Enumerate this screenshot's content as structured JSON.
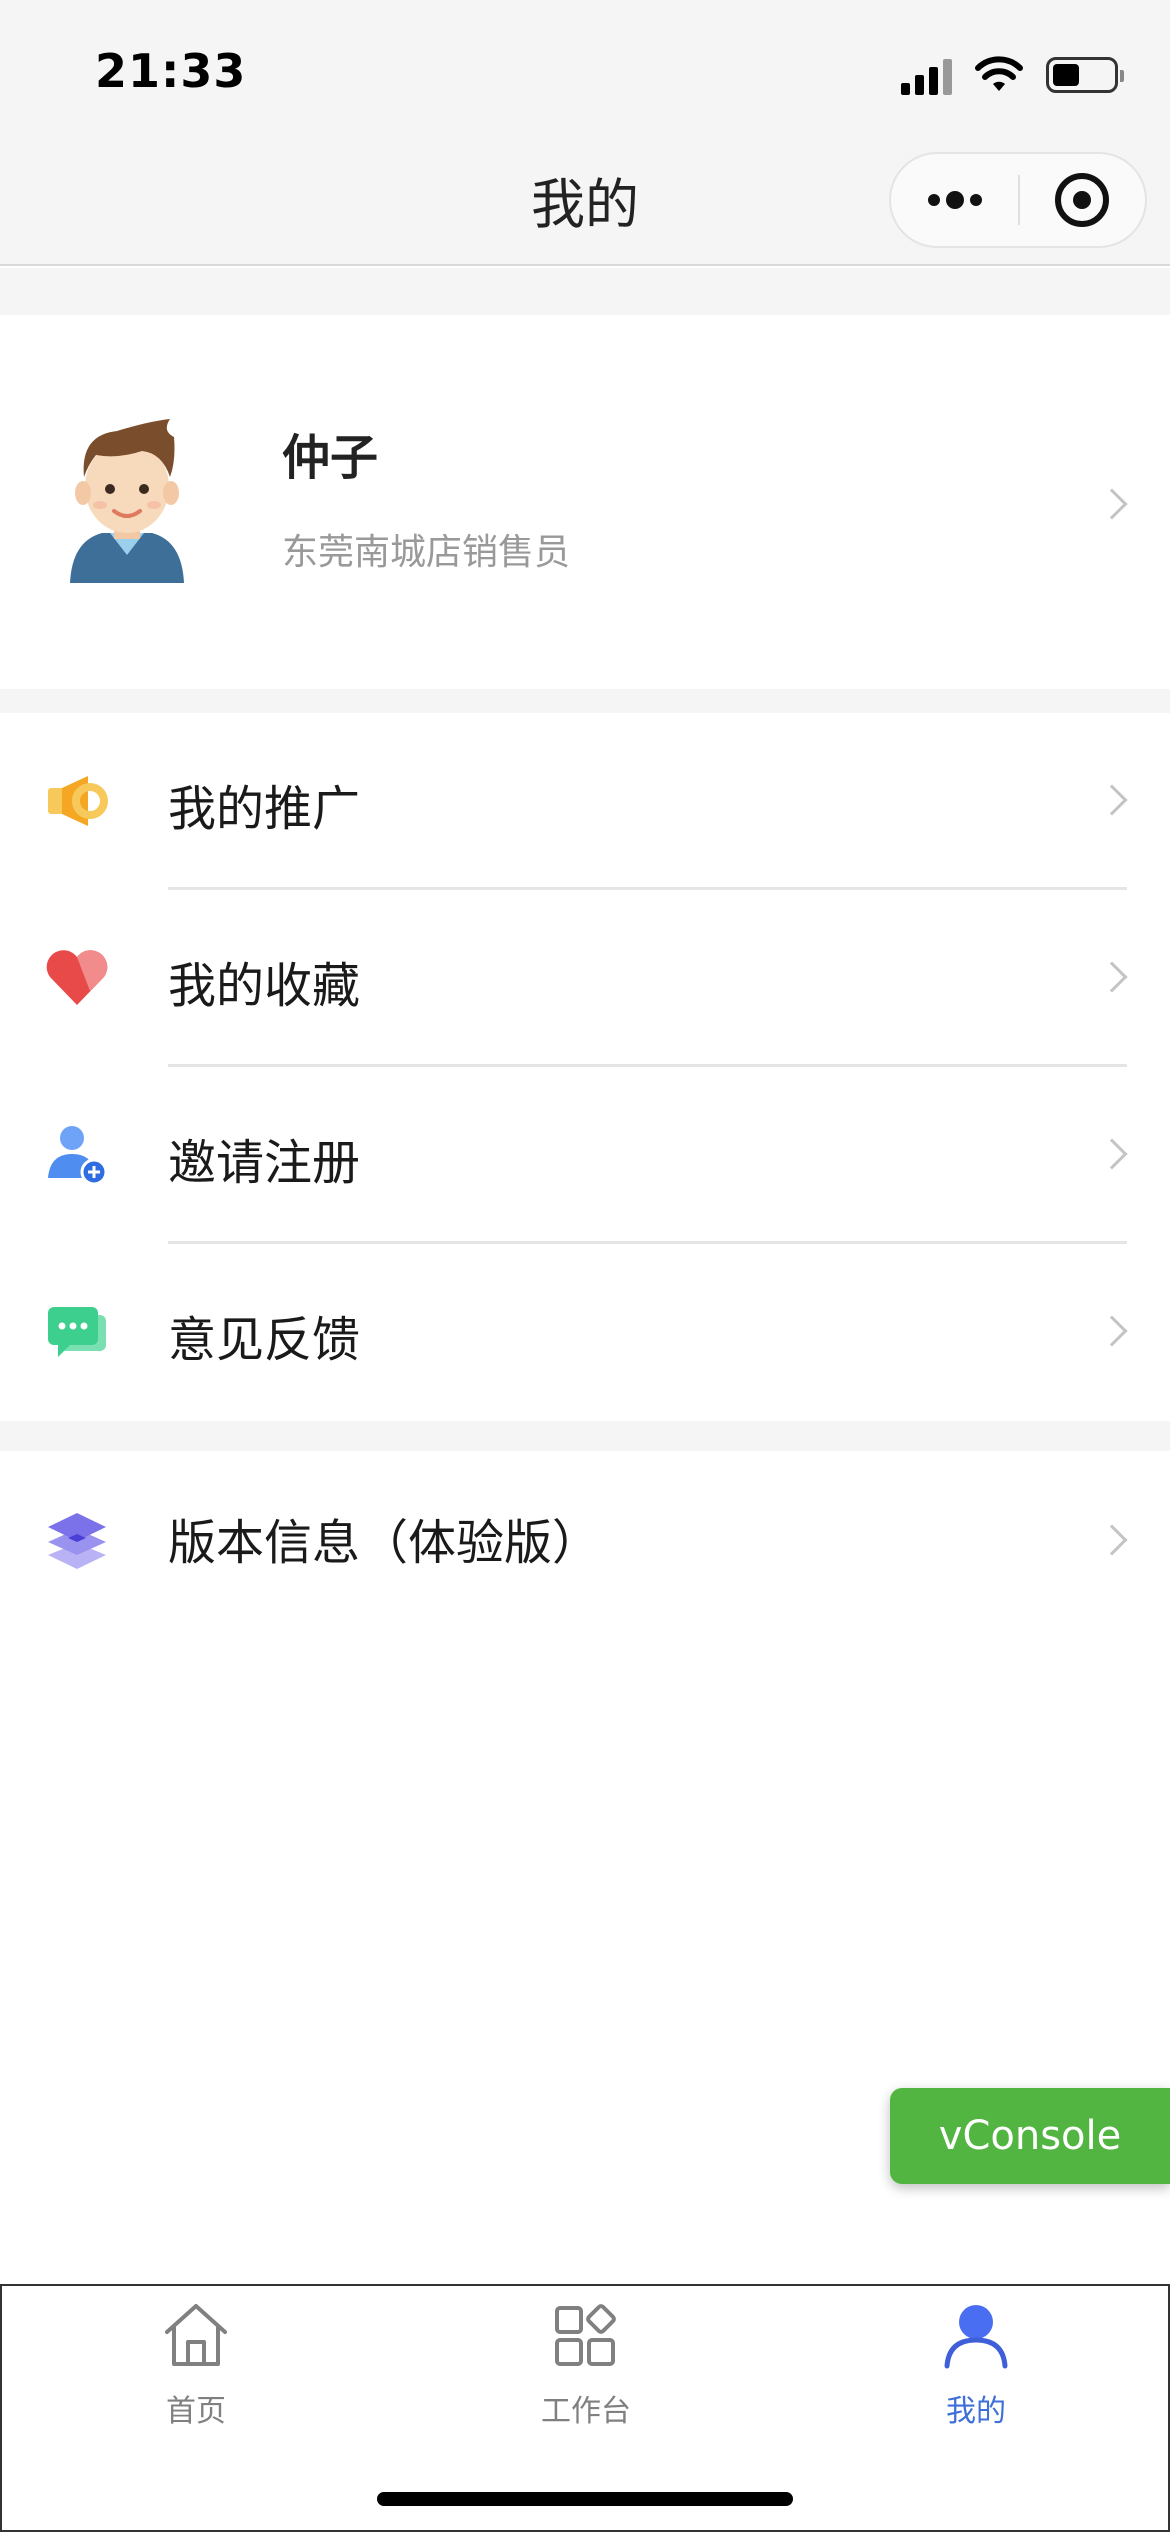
{
  "status_bar": {
    "time": "21:33",
    "battery_level": 0.45
  },
  "nav": {
    "title": "我的"
  },
  "profile": {
    "name": "仲子",
    "role": "东莞南城店销售员"
  },
  "menu": [
    {
      "label": "我的推广",
      "icon": "megaphone-icon",
      "color": "#f5a623"
    },
    {
      "label": "我的收藏",
      "icon": "heart-icon",
      "color": "#e84a4a"
    },
    {
      "label": "邀请注册",
      "icon": "add-user-icon",
      "color": "#4f8ef0"
    },
    {
      "label": "意见反馈",
      "icon": "chat-bubble-icon",
      "color": "#3ccf8e"
    }
  ],
  "version": {
    "label": "版本信息（体验版）",
    "icon": "layers-icon",
    "color": "#7b72e9"
  },
  "vconsole": {
    "label": "vConsole"
  },
  "tabbar": {
    "items": [
      {
        "label": "首页",
        "icon": "home-icon"
      },
      {
        "label": "工作台",
        "icon": "grid-icon"
      },
      {
        "label": "我的",
        "icon": "user-icon",
        "active": true
      }
    ],
    "active_color": "#3f6fd8"
  }
}
